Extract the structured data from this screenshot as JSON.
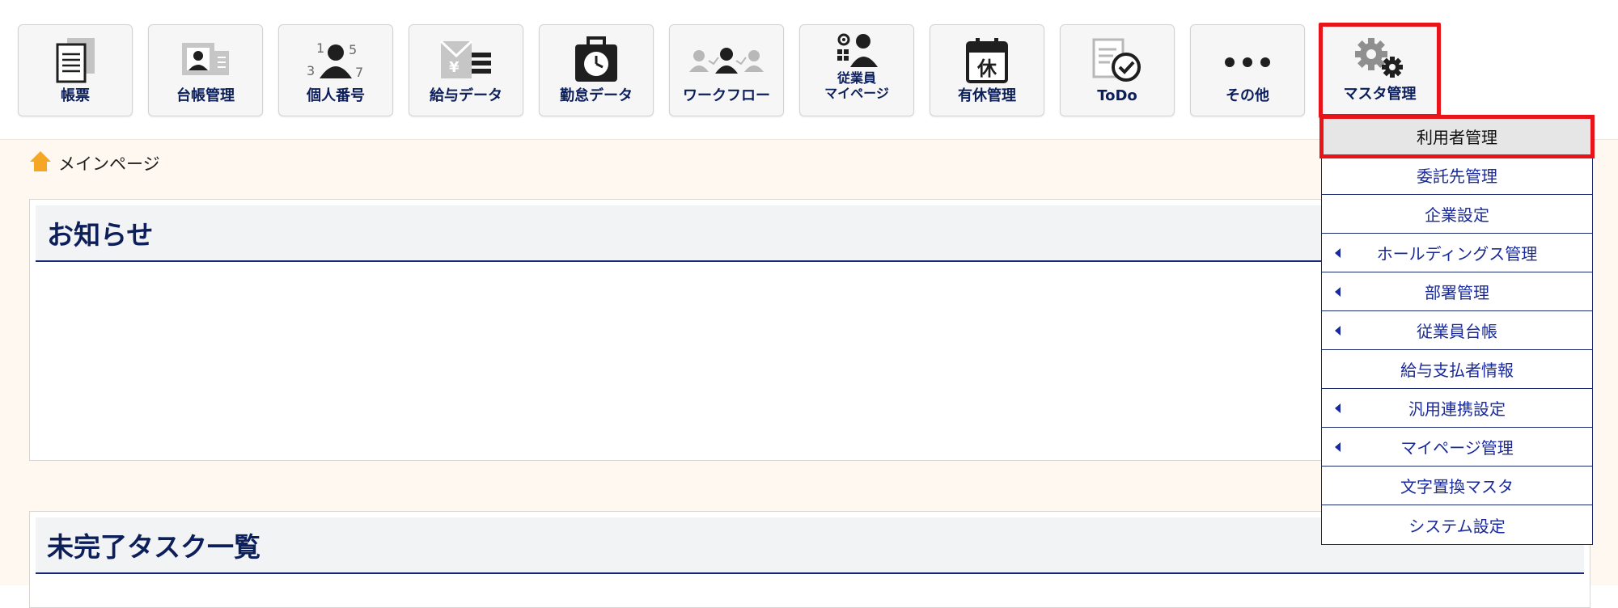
{
  "nav": {
    "tiles": [
      {
        "label": "帳票",
        "icon": "document-stack-icon"
      },
      {
        "label": "台帳管理",
        "icon": "id-card-icon"
      },
      {
        "label": "個人番号",
        "icon": "person-number-icon"
      },
      {
        "label": "給与データ",
        "icon": "yen-envelope-icon"
      },
      {
        "label": "勤怠データ",
        "icon": "clock-briefcase-icon"
      },
      {
        "label": "ワークフロー",
        "icon": "workflow-people-icon"
      },
      {
        "label": "従業員\nマイページ",
        "icon": "employee-mypage-icon"
      },
      {
        "label": "有休管理",
        "icon": "calendar-leave-icon"
      },
      {
        "label": "ToDo",
        "icon": "todo-check-icon"
      },
      {
        "label": "その他",
        "icon": "more-dots-icon"
      },
      {
        "label": "マスタ管理",
        "icon": "gears-icon"
      }
    ],
    "calendar_glyph": "休",
    "yen_glyph": "¥",
    "digits": [
      "1",
      "5",
      "3",
      "7"
    ]
  },
  "breadcrumb": {
    "label": "メインページ",
    "icon": "home-icon"
  },
  "panels": {
    "notice_title": "お知らせ",
    "tasks_title": "未完了タスク一覧"
  },
  "master_menu": {
    "items": [
      {
        "label": "利用者管理",
        "submenu": false
      },
      {
        "label": "委託先管理",
        "submenu": false
      },
      {
        "label": "企業設定",
        "submenu": false
      },
      {
        "label": "ホールディングス管理",
        "submenu": true
      },
      {
        "label": "部署管理",
        "submenu": true
      },
      {
        "label": "従業員台帳",
        "submenu": true
      },
      {
        "label": "給与支払者情報",
        "submenu": false
      },
      {
        "label": "汎用連携設定",
        "submenu": true
      },
      {
        "label": "マイページ管理",
        "submenu": true
      },
      {
        "label": "文字置換マスタ",
        "submenu": false
      },
      {
        "label": "システム設定",
        "submenu": false
      }
    ]
  },
  "colors": {
    "accent_red": "#e8141a",
    "navy": "#0c1f5a",
    "link_blue": "#1a2a9a",
    "content_bg": "#fff8f0",
    "home_orange": "#f5a623"
  }
}
